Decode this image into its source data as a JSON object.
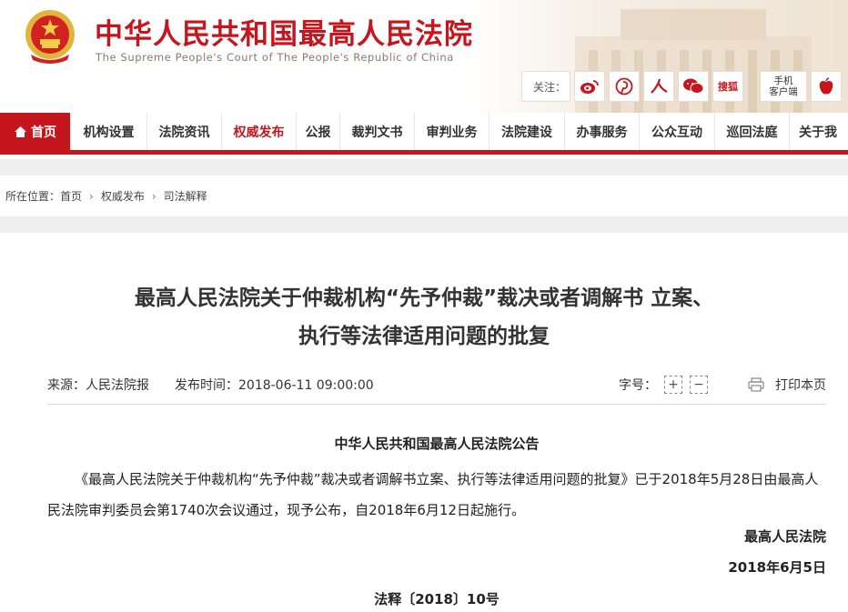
{
  "header": {
    "title": "中华人民共和国最高人民法院",
    "subtitle": "The Supreme People's Court of The People's Republic of China",
    "follow_label": "关注：",
    "social": [
      {
        "name": "weibo-icon"
      },
      {
        "name": "pinterest-icon"
      },
      {
        "name": "renmin-icon"
      },
      {
        "name": "wechat-icon"
      },
      {
        "name": "sohu-icon",
        "text": "搜狐"
      }
    ],
    "mobile_line1": "手机",
    "mobile_line2": "客户端"
  },
  "nav": {
    "items": [
      {
        "label": "首页"
      },
      {
        "label": "机构设置"
      },
      {
        "label": "法院资讯"
      },
      {
        "label": "权威发布"
      },
      {
        "label": "公报"
      },
      {
        "label": "裁判文书"
      },
      {
        "label": "审判业务"
      },
      {
        "label": "法院建设"
      },
      {
        "label": "办事服务"
      },
      {
        "label": "公众互动"
      },
      {
        "label": "巡回法庭"
      },
      {
        "label": "关于我"
      }
    ],
    "active_index": 3
  },
  "breadcrumb": {
    "prefix": "所在位置：",
    "items": [
      "首页",
      "权威发布",
      "司法解释"
    ]
  },
  "article": {
    "title_line1": "最高人民法院关于仲裁机构“先予仲裁”裁决或者调解书 立案、",
    "title_line2": "执行等法律适用问题的批复",
    "source": "来源：人民法院报",
    "publish_time": "发布时间：2018-06-11 09:00:00",
    "font_size_label": "字号：",
    "font_plus": "+",
    "font_minus": "−",
    "print_label": "打印本页",
    "heading": "中华人民共和国最高人民法院公告",
    "paragraph": "《最高人民法院关于仲裁机构“先予仲裁”裁决或者调解书立案、执行等法律适用问题的批复》已于2018年5月28日由最高人民法院审判委员会第1740次会议通过，现予公布，自2018年6月12日起施行。",
    "signature": "最高人民法院",
    "sign_date": "2018年6月5日",
    "doc_number": "法释〔2018〕10号"
  },
  "colors": {
    "brand_red": "#c5161d"
  }
}
